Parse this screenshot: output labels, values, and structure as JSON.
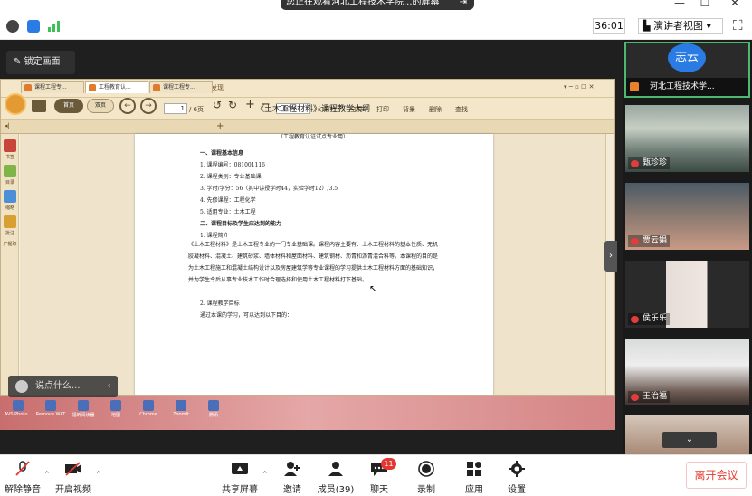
{
  "window": {
    "share_banner": "您正在观看河北工程技术学院...的屏幕",
    "minimize": "—",
    "maximize": "☐",
    "close": "✕"
  },
  "status": {
    "timer": "36:01",
    "view_button": "演讲者视图 ▾",
    "fullscreen": "⛶"
  },
  "share": {
    "lock_button": "锁定画面",
    "collapse_handle": "›"
  },
  "reader": {
    "menu": [
      "阅读",
      "注释",
      "转换",
      "编辑",
      "手机",
      "云盘",
      "发现"
    ],
    "toolbar": {
      "home": "首页",
      "bookshelf": "双页",
      "page_current": "1",
      "page_total": "/ 6页",
      "zoom": "100%",
      "slideshow": "幻灯片",
      "fullscreen": "全屏",
      "print": "打印",
      "background": "背景",
      "delete": "删除",
      "find": "查找"
    },
    "tabs": [
      "课程工程专...",
      "工程教育认...",
      "课程工程专..."
    ],
    "side": [
      "书签",
      "目录",
      "缩略",
      "批注",
      "产提取"
    ]
  },
  "document": {
    "title": "《土木工程材料》课程教学大纲",
    "subtitle": "（工程教育认证试点专业用）",
    "lines": [
      {
        "text": "一、课程基本信息",
        "bold": true
      },
      {
        "text": "1. 课程编号：081001116",
        "bold": false
      },
      {
        "text": "2. 课程类别：专业基础课",
        "bold": false
      },
      {
        "text": "3. 学时/学分：56（其中讲授学时44，实验学时12）/3.5",
        "bold": false
      },
      {
        "text": "4. 先修课程：工程化学",
        "bold": false
      },
      {
        "text": "5. 适用专业：土木工程",
        "bold": false
      },
      {
        "text": "二、课程目标及学生应达到的能力",
        "bold": true
      },
      {
        "text": "1. 课程简介",
        "bold": false
      }
    ],
    "paragraph": "《土木工程材料》是土木工程专业的一门专业基础课。课程内容主要有：土木工程材料的基本性质、无机胶凝材料、混凝土、建筑砂浆、墙体材料和屋面材料、建筑钢材、沥青和沥青混合料等。本课程的目的是为土木工程施工和混凝土结构设计以及房屋建筑学等专业课程的学习提供土木工程材料方面的基础知识，并为学生今后从事专业技术工作时合理选择和使用土木工程材料打下基础。",
    "tail_lines": [
      "2. 课程教学目标",
      "通过本课的学习，可以达到以下目的："
    ]
  },
  "chat_bar": {
    "placeholder": "说点什么...",
    "more": "‹"
  },
  "desktop_icons": [
    "AVS Photo...",
    "Remove WAT",
    "福昕阅读器",
    "地图",
    "Chrome",
    "ZoomIt",
    "腾讯"
  ],
  "participants": {
    "host": {
      "avatar_text": "志云",
      "name": "河北工程技术学..."
    },
    "list": [
      {
        "name": "甄珍珍"
      },
      {
        "name": "贾云娟"
      },
      {
        "name": "侯乐乐"
      },
      {
        "name": "王治福"
      }
    ],
    "scroll_down": "⌄"
  },
  "bottom_toolbar": {
    "mute": "解除静音",
    "video": "开启视频",
    "share": "共享屏幕",
    "invite": "邀请",
    "members": "成员(39)",
    "chat": "聊天",
    "chat_badge": "11",
    "record": "录制",
    "apps": "应用",
    "settings": "设置",
    "leave": "离开会议"
  },
  "colors": {
    "accent": "#2a7be4",
    "danger": "#e3382f",
    "active_speaker": "#4fb870"
  }
}
